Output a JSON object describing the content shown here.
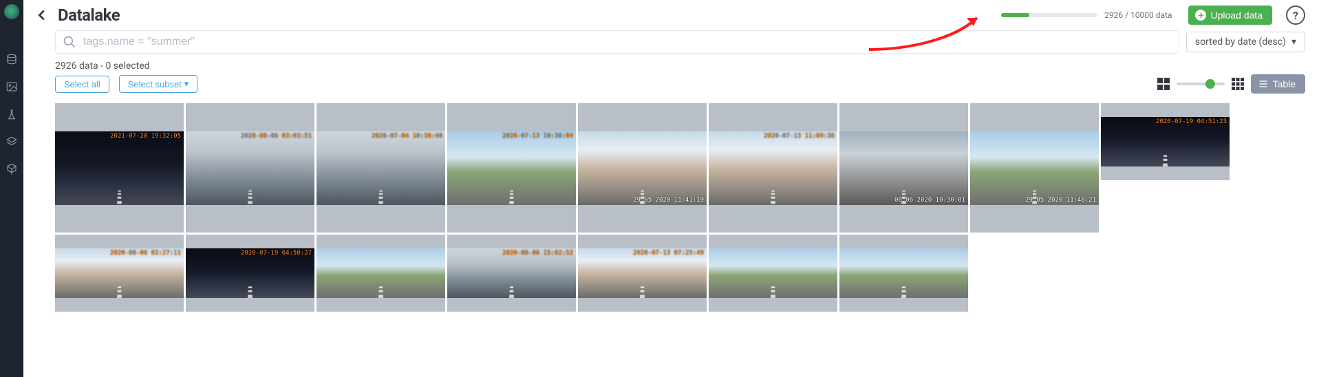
{
  "header": {
    "title": "Datalake",
    "progress": {
      "current": 2926,
      "total": 10000,
      "suffix": "data",
      "percent": 29.3
    },
    "upload_label": "Upload data",
    "help_label": "?"
  },
  "search": {
    "placeholder": "tags.name = \"summer\""
  },
  "sort": {
    "label": "sorted by date (desc)"
  },
  "status": {
    "count": 2926,
    "selected": 0
  },
  "buttons": {
    "select_all": "Select all",
    "select_subset": "Select subset",
    "table": "Table"
  },
  "rail": {
    "items": [
      "datasets",
      "images",
      "experiments",
      "layers",
      "models"
    ]
  },
  "thumbs": [
    {
      "scene": "night",
      "ts": "2021-07-20 19:32:05"
    },
    {
      "scene": "cloudy",
      "ts": "2020-08-06 03:03:51"
    },
    {
      "scene": "cloudy",
      "ts": "2020-07-04 10:38:40"
    },
    {
      "scene": "day",
      "ts": "2020-07-13 10:38:04"
    },
    {
      "scene": "urban",
      "ts_bl": "29 05 2020 11:41:19"
    },
    {
      "scene": "urban",
      "ts": "2020-07-13 11:09:36"
    },
    {
      "scene": "rain",
      "ts_bl": "06 06 2020 10:30:01"
    },
    {
      "scene": "day",
      "ts_bl": "29 05 2020 11:48:21"
    },
    {
      "scene": "night",
      "ts": "2020-07-19 04:51:23"
    },
    {
      "scene": "urban",
      "ts": "2020-08-06 02:27:11"
    },
    {
      "scene": "night",
      "ts": "2020-07-19 04:50:27"
    },
    {
      "scene": "day",
      "ts": ""
    },
    {
      "scene": "cloudy",
      "ts": "2020-08-06 15:02:52"
    },
    {
      "scene": "urban",
      "ts": "2020-07-13 07:25:49"
    },
    {
      "scene": "day",
      "ts": ""
    },
    {
      "scene": "day",
      "ts": ""
    }
  ]
}
